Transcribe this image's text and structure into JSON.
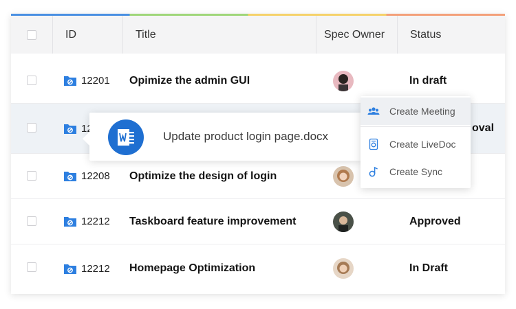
{
  "table": {
    "headers": {
      "id": "ID",
      "title": "Title",
      "owner": "Spec Owner",
      "status": "Status"
    },
    "rows": [
      {
        "id": "12201",
        "title": "Opimize the admin GUI",
        "status": "In draft"
      },
      {
        "id": "12",
        "title": "",
        "status": "oval"
      },
      {
        "id": "12208",
        "title": "Optimize the design of login",
        "status": ""
      },
      {
        "id": "12212",
        "title": "Taskboard feature improvement",
        "status": "Approved"
      },
      {
        "id": "12212",
        "title": "Homepage Optimization",
        "status": "In Draft"
      }
    ]
  },
  "doc_popup": {
    "filename": "Update product login page.docx"
  },
  "context_menu": {
    "items": [
      {
        "label": "Create Meeting"
      },
      {
        "label": "Create LiveDoc"
      },
      {
        "label": "Create Sync"
      }
    ]
  },
  "colors": {
    "accent": "#1f6fd1",
    "folder": "#2d7fe0",
    "row_highlight": "#eef2f6"
  }
}
